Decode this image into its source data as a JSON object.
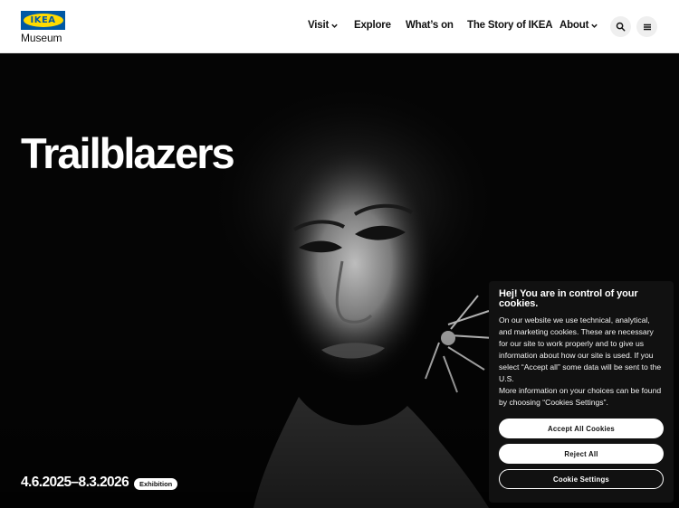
{
  "header": {
    "logo_mark": "IKEA",
    "logo_sub": "Museum",
    "nav": [
      {
        "label": "Visit",
        "has_dropdown": true
      },
      {
        "label": "Explore",
        "has_dropdown": false
      },
      {
        "label": "What’s on",
        "has_dropdown": false
      },
      {
        "label": "The Story of IKEA",
        "has_dropdown": false
      },
      {
        "label": "About",
        "has_dropdown": true
      }
    ],
    "icons": [
      "search-icon",
      "menu-icon"
    ]
  },
  "hero": {
    "title": "Trailblazers",
    "dates": "4.6.2025–8.3.2026",
    "badge": "Exhibition"
  },
  "cookie": {
    "title": "Hej! You are in control of your cookies.",
    "body_1": "On our website we use technical, analytical, and marketing cookies. These are necessary for our site to work properly and to give us information about how our site is used. If you select “Accept all” some data will be sent to the U.S.",
    "body_2": "More information on your choices can be found by choosing “Cookies Settings”.",
    "accept_label": "Accept All Cookies",
    "reject_label": "Reject All",
    "settings_label": "Cookie Settings"
  },
  "colors": {
    "ikea_blue": "#0058a3",
    "ikea_yellow": "#ffdb00",
    "header_bg": "#ffffff",
    "hero_bg": "#000000",
    "banner_bg": "#111111"
  }
}
